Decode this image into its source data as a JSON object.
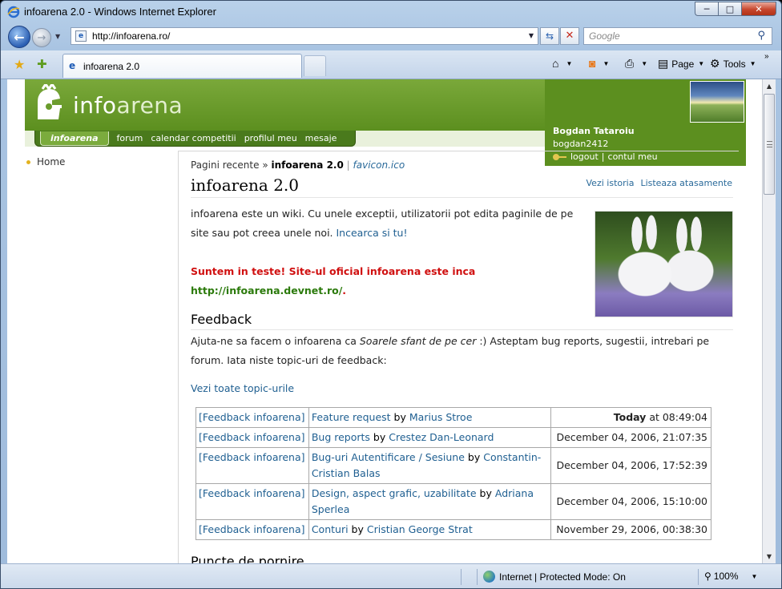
{
  "window": {
    "title": "infoarena 2.0 - Windows Internet Explorer",
    "controls": {
      "minimize": "─",
      "maximize": "□",
      "close": "✕"
    }
  },
  "navbar": {
    "url": "http://infoarena.ro/",
    "search_placeholder": "Google"
  },
  "tabs": [
    {
      "label": "infoarena 2.0"
    }
  ],
  "commands": {
    "page": "Page",
    "tools": "Tools"
  },
  "site": {
    "logo_left": "info",
    "logo_right": "arena",
    "menu_active": "infoarena",
    "menu": [
      "forum",
      "calendar competitii",
      "profilul meu",
      "mesaje"
    ],
    "user": {
      "name": "Bogdan Tataroiu",
      "login": "bogdan2412",
      "logout": "logout",
      "separator": "|",
      "account": "contul meu"
    },
    "sidebar": {
      "home": "Home"
    }
  },
  "page": {
    "breadcrumb": {
      "recent": "Pagini recente",
      "arrow": "»",
      "current": "infoarena 2.0",
      "sep": "|",
      "file": "favicon.ico"
    },
    "title": "infoarena 2.0",
    "actions": {
      "history": "Vezi istoria",
      "attachments": "Listeaza atasamente"
    },
    "intro_text": "infoarena este un wiki. Cu unele exceptii, utilizatorii pot edita paginile de pe site sau pot creea unele noi. ",
    "intro_link": "Incearca si tu!",
    "warning_red": "Suntem in teste! Site-ul oficial infoarena este inca",
    "warning_link": "http://infoarena.devnet.ro/",
    "warning_end": ".",
    "feedback_title": "Feedback",
    "feedback_pre": "Ajuta-ne sa facem o infoarena ca ",
    "feedback_em": "Soarele sfant de pe cer",
    "feedback_post": " :) Asteptam bug reports, sugestii, intrebari pe forum. Iata niste topic-uri de feedback:",
    "all_topics": "Vezi toate topic-urile",
    "by": "by",
    "topics": [
      {
        "category": "[Feedback infoarena]",
        "title": "Feature request",
        "author": "Marius Stroe",
        "date_bold": "Today",
        "date": " at 08:49:04"
      },
      {
        "category": "[Feedback infoarena]",
        "title": "Bug reports",
        "author": "Crestez Dan-Leonard",
        "date_bold": "",
        "date": "December 04, 2006, 21:07:35"
      },
      {
        "category": "[Feedback infoarena]",
        "title": "Bug-uri Autentificare / Sesiune",
        "author": "Constantin-Cristian Balas",
        "date_bold": "",
        "date": "December 04, 2006, 17:52:39"
      },
      {
        "category": "[Feedback infoarena]",
        "title": "Design, aspect grafic, uzabilitate",
        "author": "Adriana Sperlea",
        "date_bold": "",
        "date": "December 04, 2006, 15:10:00"
      },
      {
        "category": "[Feedback infoarena]",
        "title": "Conturi",
        "author": "Cristian George Strat",
        "date_bold": "",
        "date": "November 29, 2006, 00:38:30"
      }
    ],
    "next_section": "Puncte de pornire"
  },
  "statusbar": {
    "zone": "Internet | Protected Mode: On",
    "zoom": "100%"
  }
}
